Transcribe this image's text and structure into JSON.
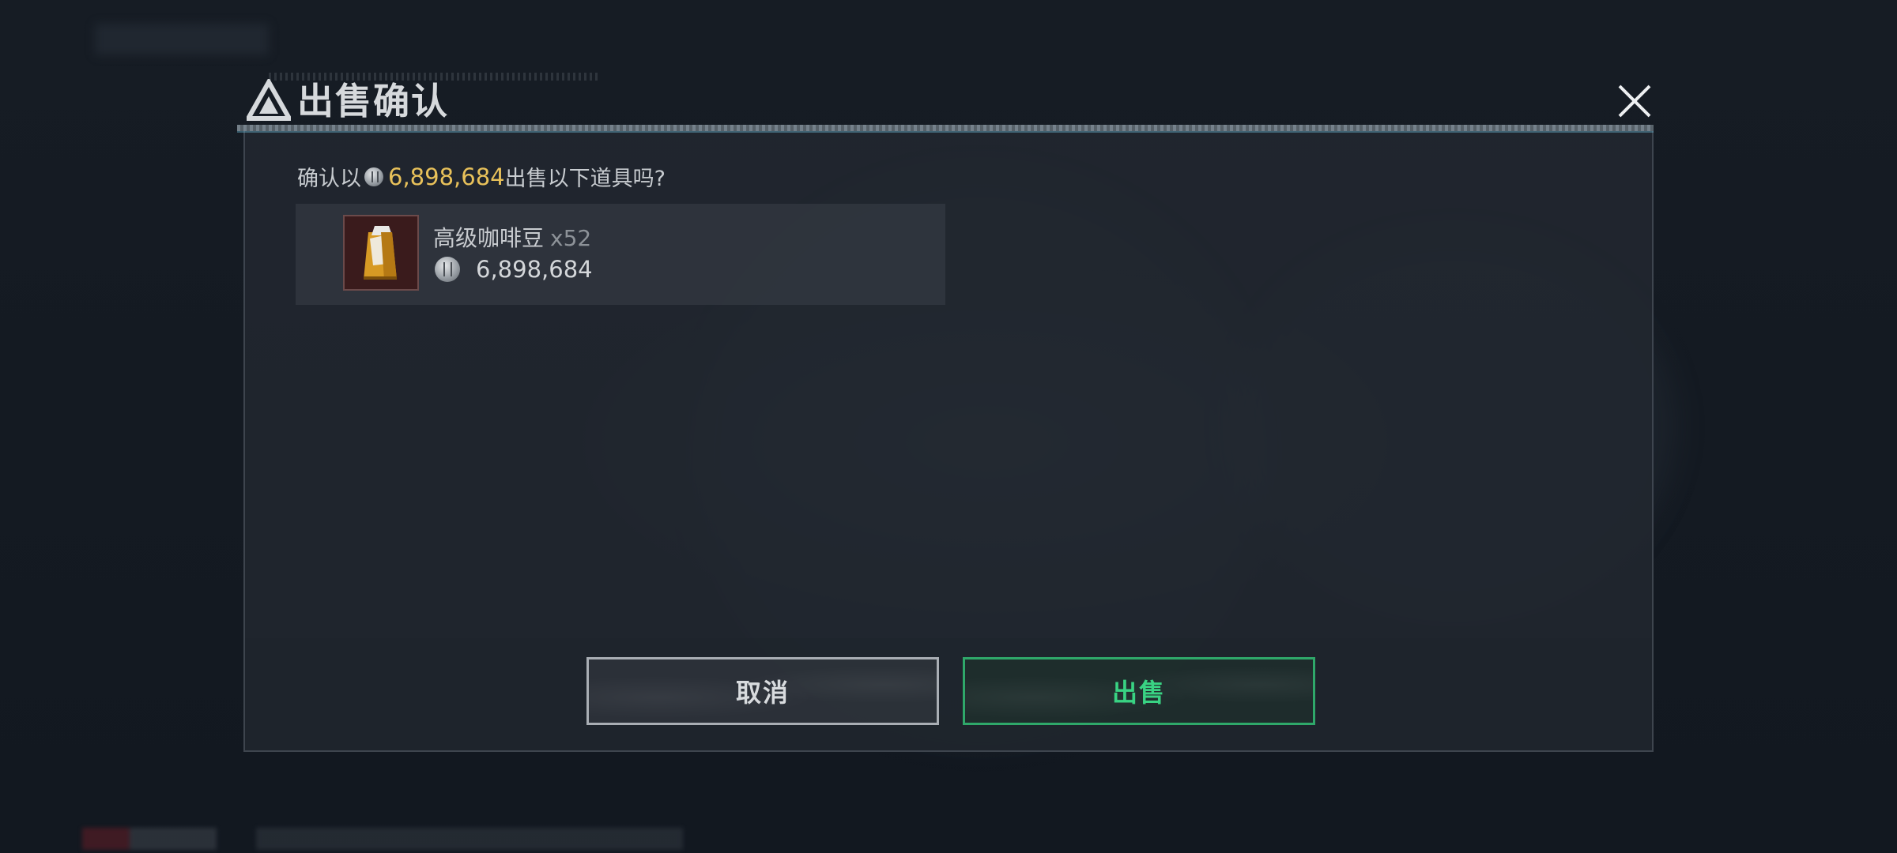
{
  "dialog": {
    "title": "出售确认",
    "prompt_prefix": "确认以",
    "prompt_amount": "6,898,684",
    "prompt_suffix": "出售以下道具吗?"
  },
  "item": {
    "name": "高级咖啡豆",
    "quantity": "x52",
    "price": "6,898,684",
    "icon": "coffee-bean-bag-icon"
  },
  "buttons": {
    "cancel_label": "取消",
    "sell_label": "出售"
  },
  "colors": {
    "accent_gold": "#e8c15a",
    "sell_green": "#39d383",
    "panel_bg": "#22282f"
  }
}
